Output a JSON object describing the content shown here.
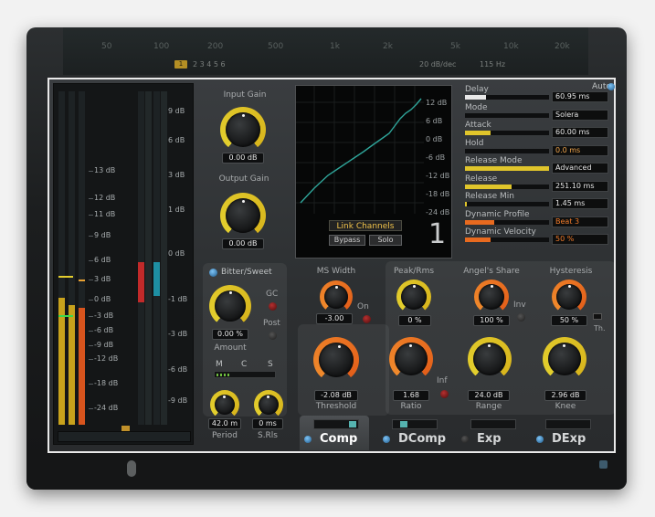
{
  "top": {
    "freq_labels": [
      "50",
      "100",
      "200",
      "500",
      "1k",
      "2k",
      "5k",
      "10k",
      "20k"
    ],
    "badge": "1",
    "row2_left": "2  3  4  5  6",
    "row2_db": "20 dB/dec",
    "row2_hz": "115 Hz"
  },
  "meters": {
    "scale_left": [
      "13 dB",
      "12 dB",
      "11 dB",
      "9 dB",
      "6 dB",
      "3 dB",
      "0 dB",
      "-3 dB",
      "-6 dB",
      "-9 dB",
      "-12 dB",
      "-18 dB",
      "-24 dB"
    ],
    "scale_right": [
      "9 dB",
      "6 dB",
      "3 dB",
      "1 dB",
      "0 dB",
      "-1 dB",
      "-3 dB",
      "-6 dB",
      "-9 dB"
    ],
    "levels": {
      "left_a": 0.38,
      "left_b": 0.36,
      "left_c": 0.35,
      "gr_a": 0.12,
      "gr_b": 0.1
    }
  },
  "input_gain": {
    "label": "Input Gain",
    "value": "0.00 dB"
  },
  "output_gain": {
    "label": "Output Gain",
    "value": "0.00 dB"
  },
  "graph": {
    "scale": [
      "12 dB",
      "6 dB",
      "0 dB",
      "-6 dB",
      "-12 dB",
      "-18 dB",
      "-24 dB"
    ],
    "link": "Link Channels",
    "bypass": "Bypass",
    "solo": "Solo",
    "number": "1"
  },
  "params": [
    {
      "name": "Delay",
      "value": "60.95 ms",
      "fill": 0.25,
      "color": "#e8e8e8",
      "valcolor": "#e4e4e4"
    },
    {
      "name": "Mode",
      "value": "Solera",
      "fill": 0,
      "color": "#e8e8e8",
      "valcolor": "#e4e4e4"
    },
    {
      "name": "Attack",
      "value": "60.00 ms",
      "fill": 0.3,
      "color": "#e0c52b",
      "valcolor": "#e4e4e4"
    },
    {
      "name": "Hold",
      "value": "0.0 ms",
      "fill": 0,
      "color": "#e0c52b",
      "valcolor": "#f0a44a"
    },
    {
      "name": "Release Mode",
      "value": "Advanced",
      "fill": 1,
      "color": "#e0c52b",
      "valcolor": "#e4e4e4"
    },
    {
      "name": "Release",
      "value": "251.10 ms",
      "fill": 0.55,
      "color": "#e0c52b",
      "valcolor": "#e4e4e4"
    },
    {
      "name": "Release Min",
      "value": "1.45 ms",
      "fill": 0.02,
      "color": "#e0c52b",
      "valcolor": "#e4e4e4"
    },
    {
      "name": "Dynamic Profile",
      "value": "Beat 3",
      "fill": 0.35,
      "color": "#e86a1f",
      "valcolor": "#f07a2a"
    },
    {
      "name": "Dynamic Velocity",
      "value": "50 %",
      "fill": 0.3,
      "color": "#e86a1f",
      "valcolor": "#f07a2a"
    }
  ],
  "auto_label": "Auto",
  "bitter": {
    "label": "Bitter/Sweet",
    "value": "0.00 %",
    "amount": "Amount",
    "gc": "GC",
    "post": "Post"
  },
  "mcs": {
    "m": "M",
    "c": "C",
    "s": "S"
  },
  "period": {
    "value": "42.0 m",
    "label": "Period"
  },
  "srls": {
    "value": "0 ms",
    "label": "S.Rls"
  },
  "mswidth": {
    "label": "MS Width",
    "value": "-3.00",
    "on": "On"
  },
  "peakrms": {
    "label": "Peak/Rms",
    "value": "0 %"
  },
  "angels": {
    "label": "Angel's Share",
    "value": "100 %",
    "inv": "Inv"
  },
  "hysteresis": {
    "label": "Hysteresis",
    "value": "50 %",
    "th": "Th."
  },
  "threshold": {
    "value": "-2.08 dB",
    "label": "Threshold"
  },
  "ratio": {
    "value": "1.68",
    "label": "Ratio",
    "inf": "Inf"
  },
  "range": {
    "value": "24.0 dB",
    "label": "Range"
  },
  "knee": {
    "value": "2.96 dB",
    "label": "Knee"
  },
  "tabs": [
    {
      "label": "Comp",
      "active": true
    },
    {
      "label": "DComp",
      "active": false
    },
    {
      "label": "Exp",
      "active": false
    },
    {
      "label": "DExp",
      "active": false
    }
  ]
}
